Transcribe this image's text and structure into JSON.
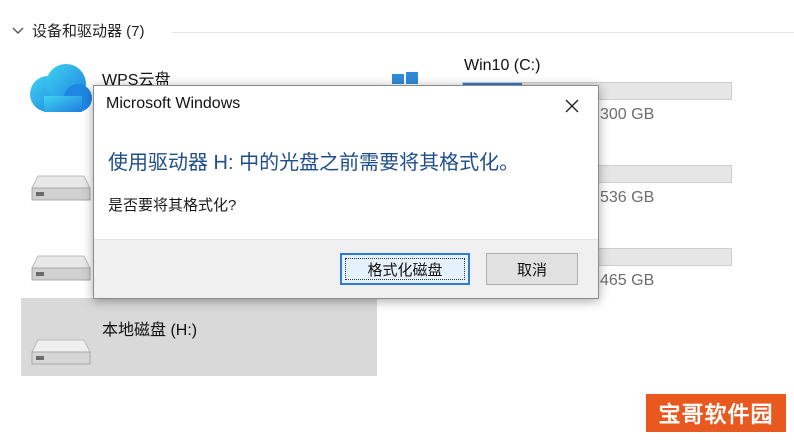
{
  "section": {
    "title": "设备和驱动器 (7)"
  },
  "items": {
    "wps": {
      "label": "WPS云盘"
    },
    "win10": {
      "label": "Win10 (C:)",
      "size_text": "300 GB",
      "usage_fraction": 0.22
    },
    "drive2": {
      "size_text": "536 GB",
      "usage_fraction": 0.0
    },
    "drive3": {
      "size_text": "465 GB",
      "usage_fraction": 0.0
    },
    "local_h": {
      "label": "本地磁盘 (H:)"
    }
  },
  "dialog": {
    "title": "Microsoft Windows",
    "heading": "使用驱动器 H: 中的光盘之前需要将其格式化。",
    "question": "是否要将其格式化?",
    "format_button": "格式化磁盘",
    "cancel_button": "取消"
  },
  "watermark": {
    "text": "宝哥软件园"
  },
  "colors": {
    "accent": "#2f7ad7",
    "heading_blue": "#1f4e8c",
    "watermark_bg": "#e8581f"
  }
}
